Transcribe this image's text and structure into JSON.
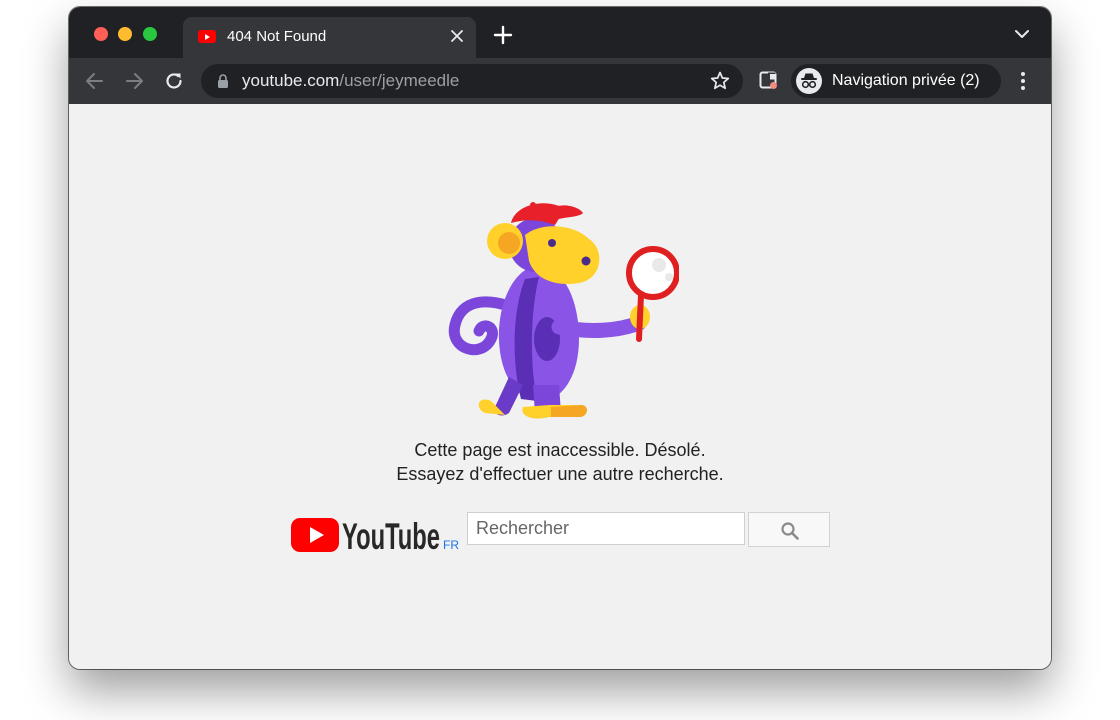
{
  "window": {
    "tab_title": "404 Not Found",
    "tab_favicon": "youtube-favicon-icon"
  },
  "toolbar": {
    "url_host": "youtube.com",
    "url_path": "/user/jeymeedle",
    "profile_label": "Navigation privée (2)",
    "icons": [
      "back-arrow-icon",
      "forward-arrow-icon",
      "reload-icon",
      "lock-icon",
      "bookmark-star-icon",
      "extension-icon",
      "incognito-icon",
      "more-vert-icon"
    ]
  },
  "page": {
    "illustration": "monkey-with-magnifying-glass",
    "error_line1": "Cette page est inaccessible. Désolé.",
    "error_line2": "Essayez d'effectuer une autre recherche.",
    "logo_text": "YouTube",
    "region_code": "FR",
    "search_placeholder": "Rechercher",
    "search_icon": "search-icon"
  },
  "colors": {
    "youtube_red": "#ff0000",
    "page_bg": "#f1f1f1",
    "chrome_dark": "#202124",
    "toolbar_bg": "#35363a"
  }
}
